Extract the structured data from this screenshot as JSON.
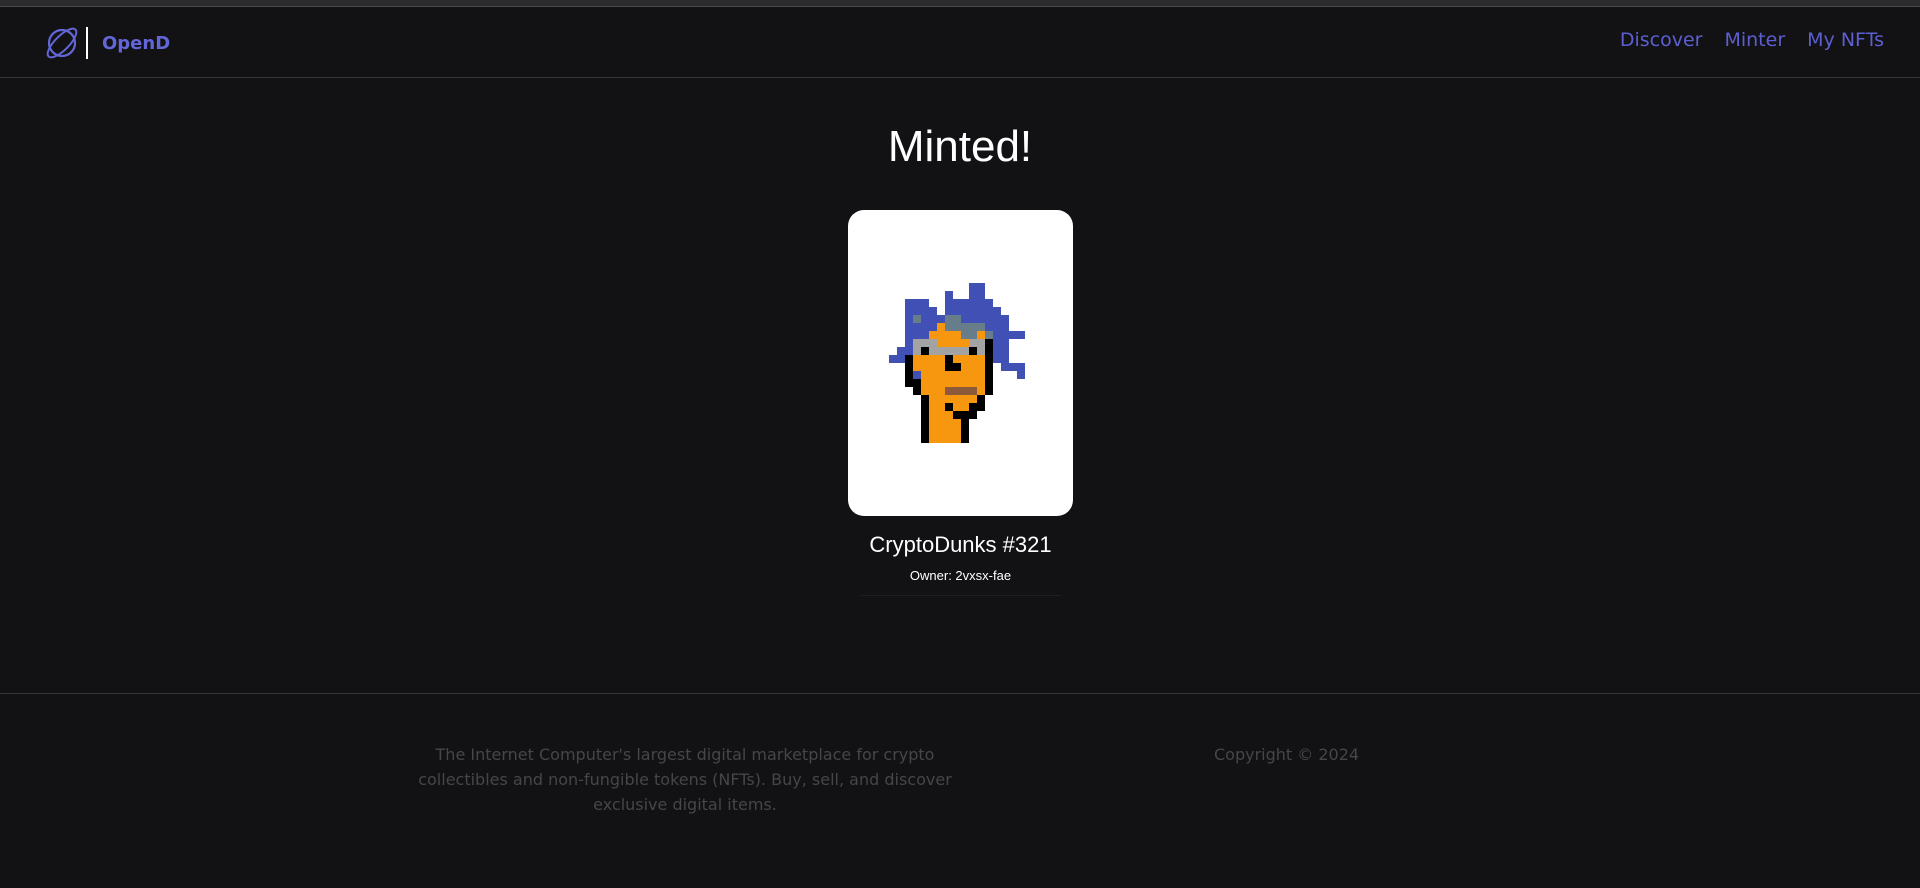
{
  "header": {
    "brand": "OpenD",
    "nav": [
      {
        "label": "Discover"
      },
      {
        "label": "Minter"
      },
      {
        "label": "My NFTs"
      }
    ]
  },
  "main": {
    "heading": "Minted!",
    "nft": {
      "name": "CryptoDunks #321",
      "owner_text": "Owner: 2vxsx-fae",
      "image_icon": "pixel-art-punk"
    }
  },
  "footer": {
    "description": "The Internet Computer's largest digital marketplace for crypto collectibles and non-fungible tokens (NFTs). Buy, sell, and discover exclusive digital items.",
    "copyright": "Copyright © 2024"
  },
  "colors": {
    "background": "#121214",
    "accent": "#5d5fd1",
    "card": "#ffffff"
  }
}
